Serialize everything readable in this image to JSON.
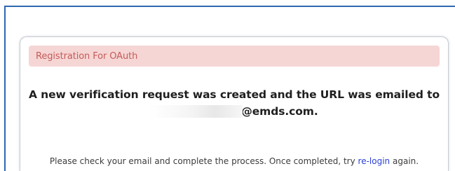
{
  "card": {
    "header_title": "Registration For OAuth",
    "message_line1": "A new verification request was created and the URL was emailed to",
    "email_suffix": "@emds.com.",
    "instruction_before_link": "Please check your email and complete the process. Once completed, try",
    "relogin_link": "re-login",
    "instruction_after_link": "again."
  },
  "colors": {
    "frame_border": "#2f67b1",
    "header_background": "#f5d6d5",
    "header_text": "#c55b58",
    "link": "#2b40d6"
  }
}
